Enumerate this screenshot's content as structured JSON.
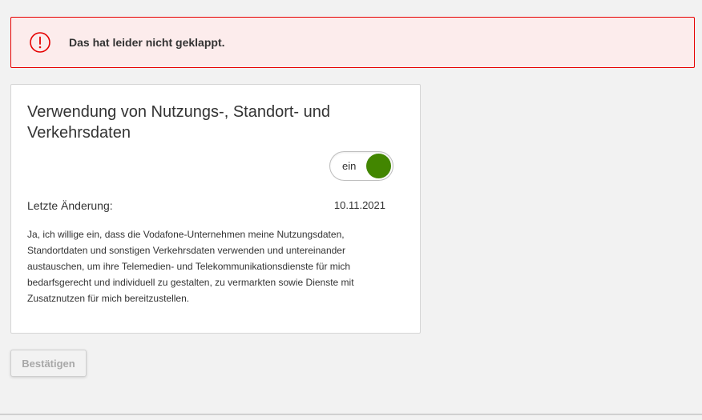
{
  "alert": {
    "icon": "warning-circle-icon",
    "message": "Das hat leider nicht geklappt.",
    "color": "#e60000"
  },
  "consent_card": {
    "title": "Verwendung von Nutzungs-, Standort- und Verkehrsdaten",
    "toggle": {
      "label": "ein",
      "state": "on",
      "color": "#428600"
    },
    "last_change_label": "Letzte Änderung:",
    "last_change_date": "10.11.2021",
    "body": "Ja, ich willige ein, dass die Vodafone-Unternehmen meine Nutzungsdaten, Standortdaten und sonstigen Verkehrsdaten verwenden und untereinander austauschen, um ihre Telemedien- und Telekommunikationsdienste für mich bedarfsgerecht und individuell zu gestalten, zu vermarkten sowie Dienste mit Zusatznutzen für mich bereitzustellen."
  },
  "actions": {
    "confirm_label": "Bestätigen",
    "confirm_disabled": true
  }
}
